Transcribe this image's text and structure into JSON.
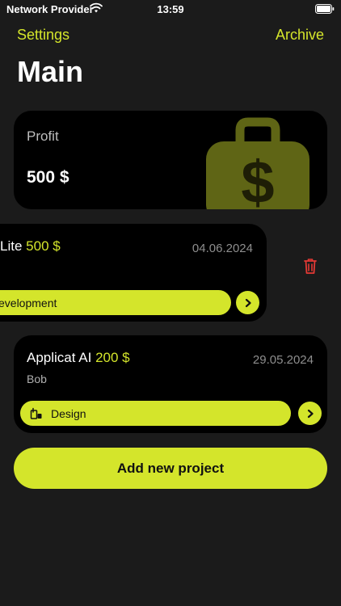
{
  "status_bar": {
    "carrier": "Network Provider",
    "time": "13:59"
  },
  "nav": {
    "settings_label": "Settings",
    "archive_label": "Archive"
  },
  "page_title": "Main",
  "profit": {
    "label": "Profit",
    "value": "500 $",
    "icon": "money-bag-icon"
  },
  "projects": [
    {
      "title": "Lite",
      "price": "500 $",
      "date": "04.06.2024",
      "client": "",
      "category": "evelopment"
    },
    {
      "title": "Applicat AI",
      "price": "200 $",
      "date": "29.05.2024",
      "client": "Bob",
      "category": "Design",
      "category_icon": "design-tools-icon"
    }
  ],
  "add_button_label": "Add new project",
  "colors": {
    "accent": "#d4e52b",
    "background": "#1b1b1b",
    "card": "#000000",
    "delete": "#e53935"
  }
}
